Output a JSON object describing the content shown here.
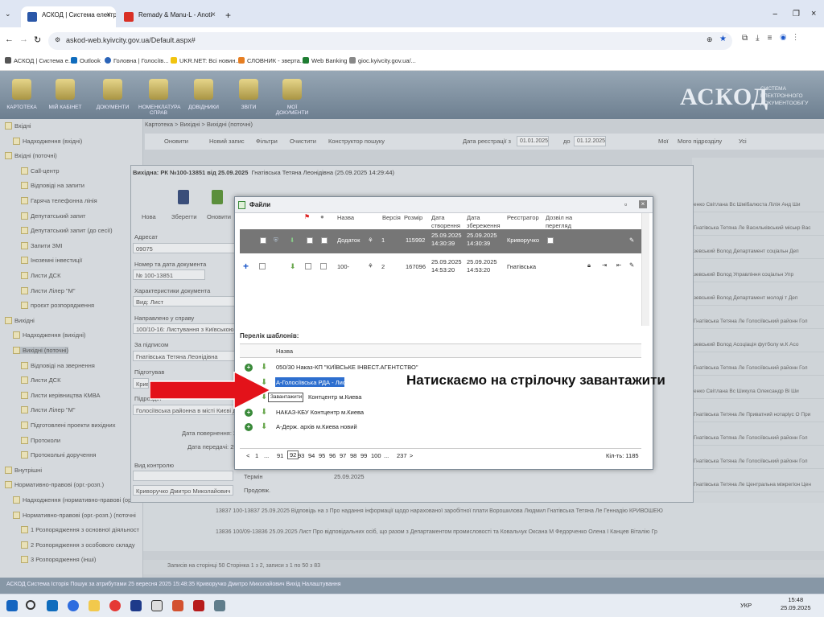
{
  "browser": {
    "tabs": [
      {
        "title": "АСКОД | Система електронно",
        "color": "#2a57a8"
      },
      {
        "title": "Remady & Manu-L - Anoti",
        "color": "#d93025"
      }
    ],
    "url": "askod-web.kyivcity.gov.ua/Default.aspx#",
    "bookmarks": [
      "АСКОД | Система е...",
      "Outlook",
      "Головна | Голосіїв...",
      "UKR.NET: Всі новин...",
      "СЛОВНИК - зверта...",
      "Web Banking",
      "gioc.kyivcity.gov.ua/..."
    ]
  },
  "app": {
    "modules": [
      "КАРТОТЕКА",
      "МІЙ КАБІНЕТ",
      "ДОКУМЕНТИ",
      "НОМЕНКЛАТУРА СПРАВ",
      "ДОВІДНИКИ",
      "ЗВІТИ",
      "МОЇ ДОКУМЕНТИ"
    ],
    "logo": "АСКОД",
    "logo_sub": "СИСТЕМА ЕЛЕКТРОННОГО ДОКУМЕНТООБІГУ",
    "breadcrumb": "Картотека > Вихідні > Вихідні (поточні)",
    "toolbar": [
      "Оновити",
      "Новий запис",
      "Фільтри",
      "Очистити",
      "Конструктор пошуку",
      "Дата реєстрації з",
      "01.01.2025",
      "до",
      "01.12.2025",
      "Мої",
      "Мого підрозділу",
      "Усі"
    ],
    "tree": [
      "Вхідні",
      "Надходження (вхідні)",
      "Вхідні (поточні)",
      "Call-центр",
      "Відповіді на запити",
      "Гаряча телефонна лінія",
      "Депутатський запит",
      "Депутатський запит (до сесії)",
      "Запити ЗМІ",
      "Іноземні інвестиції",
      "Листи ДСК",
      "Листи Лілер \"М\"",
      "проєкт розпорядження",
      "Вихідні",
      "Надходження (вихідні)",
      "Вихідні (поточні)",
      "Відповіді на звернення",
      "Листи ДСК",
      "Листи керівництва КМВА",
      "Листи Лілер \"М\"",
      "Підготовлені проекти вихідних",
      "Протоколи",
      "Протокольні доручення",
      "Внутрішні",
      "Нормативно-правові (орг.-розп.)",
      "Надходження (нормативно-правові (орг.-",
      "Нормативно-правові (орг.-розп.) (поточні",
      "1 Розпорядження з основної діяльност",
      "2 Розпорядження з особового складу",
      "3 Розпорядження (інші)"
    ],
    "document": {
      "title": "Вихідна: РК №100-13851 від 25.09.2025",
      "author_line": "Гнатівська Тетяна Леонідівна (25.09.2025 14:29:44)",
      "actions": [
        "Нова",
        "Зберегти",
        "Оновити"
      ],
      "address_label": "Адресат",
      "address_value": "09075",
      "number_label": "Номер та дата документа",
      "number_value": "№ 100-13851",
      "char_label": "Характеристики документа",
      "char_value": "Вид: Лист",
      "case_label": "Направлено у справу",
      "case_value": "100/10-16: Листування з Київською міс",
      "signed_label": "За підписом",
      "signed_value": "Гнатівська Тетяна Леонідівна",
      "prepared_label": "Підготував",
      "prepared_value": "Кривору",
      "dept_label": "Підрозділ",
      "dept_value": "Голосіївська районна в місті Києві держ",
      "return_date": "Дата повернення: 25.0",
      "send_date": "Дата передачі: 25.0",
      "control_label": "Вид контролю",
      "control_value": "Криворучко Дмитро Миколайович",
      "term": "Термін",
      "extend": "Продовж.",
      "date_val": "25.09.2025"
    },
    "grid_rows": [
      "енко Світлана Вс Шмібалюста Лілія Анд Ши",
      "Гнатівська Тетяна Ле Васильківський міськр Вас",
      "зевський Волод Департамент соціальн Деп",
      "зевський Волод Управління соціальн Упр",
      "зевський Волод Департамент молоді т Деп",
      "Гнатівська Тетяна Ле Голосіївський районн Гол",
      "зевський Волод Асоціація футболу м.К Асо",
      "Гнатівська Тетяна Ле Голосіївський районн Гол",
      "енко Світлана Вс Шикула Олександр Ві Ши",
      "Гнатівська Тетяна Ле Приватний нотаріус О При",
      "Гнатівська Тетяна Ле Голосіївський районн Гол",
      "Гнатівська Тетяна Ле Голосіївський районн Гол",
      "Гнатівська Тетяна Ле Центральна міжрегіон Цен"
    ],
    "bottom_rows": [
      "13837    100-13837    25.09.2025    Відповідь на з    Про надання інформації щодо нарахованої заробітної плати    Ворошилова Людмил Гнатівська Тетяна Ле Геннадію КРИВОШЕЮ",
      "13836    100/09-13836    25.09.2025    Лист    Про відповідальних осіб, що разом з Департаментом промисловості та    Ковальчук Оксана М Федорченко Олена І Канцев Віталію Гр"
    ],
    "pager": "Записів на сторінці 50    Сторінка 1 з 2, записи з 1 по 50 з 83",
    "status": "АСКОД Система    Історія    Пошук за атрибутами    25 вересня 2025 15:48:35    Криворучко Дмитро Миколайович    Вихід    Налаштування"
  },
  "dialog": {
    "title": "Файли",
    "headers": {
      "name": "Назва",
      "version": "Версія",
      "size": "Розмір",
      "created": "Дата створення",
      "saved": "Дата збереження",
      "registrar": "Реєстратор",
      "view": "Дозвіл на перегляд"
    },
    "files": [
      {
        "name": "Додаток",
        "version": "1",
        "size": "115992",
        "created": "25.09.2025 14:30:39",
        "saved": "25.09.2025 14:30:39",
        "registrar": "Криворучко"
      },
      {
        "name": "100-",
        "version": "2",
        "size": "167096",
        "created": "25.09.2025 14:53:20",
        "saved": "25.09.2025 14:53:20",
        "registrar": "Гнатівська"
      }
    ],
    "templates_header": "Перелік шаблонів:",
    "templates_col": "Назва",
    "templates": [
      "050/30 Наказ-КП \"КИЇВСЬКЕ ІНВЕСТ.АГЕНТСТВО\"",
      "А-Голосіївська РДА - Лист",
      "Контцентр м.Киева",
      "НАКАЗ-КБУ Контцентр м.Киева",
      "А-Держ. архів м.Киева новий"
    ],
    "tooltip": "Завантажити",
    "pages": [
      "<",
      "1",
      "...",
      "91",
      "92",
      "93",
      "94",
      "95",
      "96",
      "97",
      "98",
      "99",
      "100",
      "...",
      "237",
      ">"
    ],
    "count": "Кіл-ть: 1185"
  },
  "caption": "Натискаємо на стрілочку завантажити",
  "taskbar": {
    "lang": "УКР",
    "time": "15:48",
    "date": "25.09.2025"
  },
  "colors": {
    "arrow": "#e3121a",
    "selected_template": "#2e6fcf",
    "header": "#7d8f9f"
  }
}
